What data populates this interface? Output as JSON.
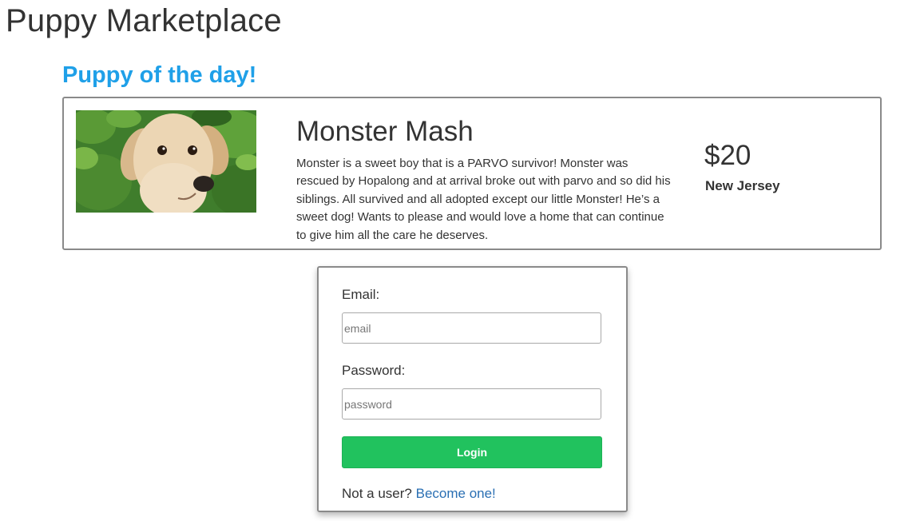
{
  "header": {
    "title": "Puppy Marketplace"
  },
  "puppy_of_the_day": {
    "section_title": "Puppy of the day!",
    "name": "Monster Mash",
    "description": "Monster is a sweet boy that is a PARVO survivor! Monster was rescued by Hopalong and at arrival broke out with parvo and so did his siblings. All survived and all adopted except our little Monster! He’s a sweet dog! Wants to please and would love a home that can continue to give him all the care he deserves.",
    "price": "$20",
    "location": "New Jersey",
    "photo_icon": "puppy-photo"
  },
  "login": {
    "email_label": "Email:",
    "email_placeholder": "email",
    "email_value": "",
    "password_label": "Password:",
    "password_placeholder": "password",
    "password_value": "",
    "submit_label": "Login",
    "signup_prompt": "Not a user?",
    "signup_link": "Become one!"
  },
  "colors": {
    "accent_blue": "#1fa0e8",
    "login_green": "#21c25e",
    "link_blue": "#2a6fb3",
    "border_gray": "#8a8a8a"
  }
}
